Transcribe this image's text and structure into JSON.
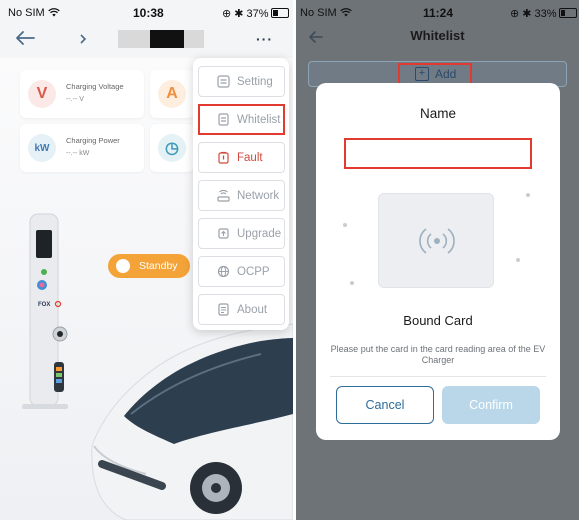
{
  "left": {
    "status": {
      "carrier": "No SIM",
      "time": "10:38",
      "battery": "37%"
    },
    "metrics": [
      {
        "label": "Charging Voltage",
        "value": "--.-- V"
      },
      {
        "label": "Charging Power",
        "value": "--.-- kW"
      }
    ],
    "standby_label": "Standby",
    "charger_brand": "FOX",
    "menu": {
      "items": [
        "Setting",
        "Whitelist",
        "Fault",
        "Network",
        "Upgrade",
        "OCPP",
        "About"
      ],
      "highlighted": "Whitelist"
    }
  },
  "right": {
    "status": {
      "carrier": "No SIM",
      "time": "11:24",
      "battery": "33%"
    },
    "title": "Whitelist",
    "add_label": "Add",
    "modal": {
      "name_label": "Name",
      "name_value": "",
      "bound_card_label": "Bound Card",
      "hint": "Please put the card in the card reading area of the EV Charger",
      "cancel_label": "Cancel",
      "confirm_label": "Confirm"
    }
  },
  "colors": {
    "accent_blue": "#2e6c9a",
    "standby_orange": "#f4a338",
    "highlight_red": "#e23a2e",
    "confirm_disabled": "#b9d7e8"
  }
}
